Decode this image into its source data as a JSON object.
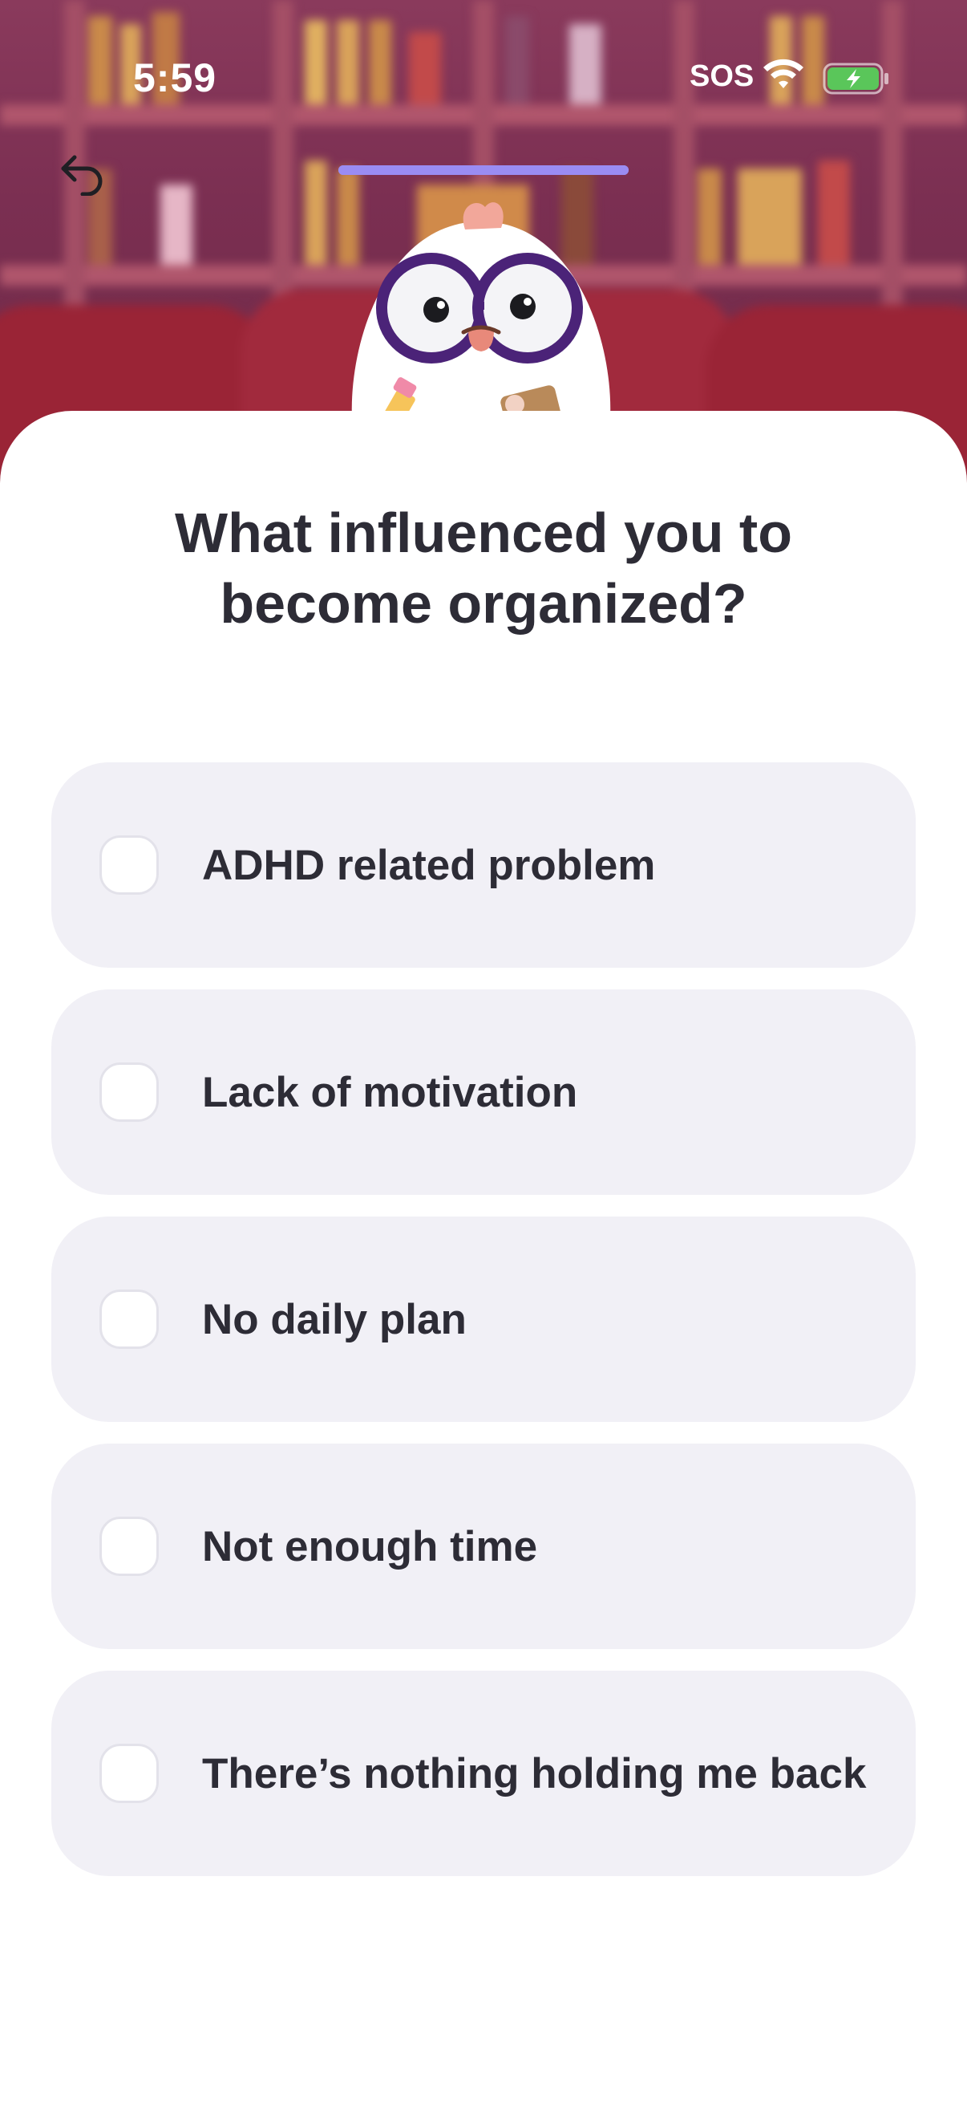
{
  "status_bar": {
    "time": "5:59",
    "carrier": "SOS",
    "wifi_icon": "wifi-icon",
    "battery_icon": "battery-charging-icon"
  },
  "nav": {
    "back_icon": "back-arrow-icon",
    "progress": 1.0
  },
  "question": {
    "title": "What influenced you to become organized?"
  },
  "options": [
    {
      "label": "ADHD related problem",
      "checked": false
    },
    {
      "label": "Lack of motivation",
      "checked": false
    },
    {
      "label": "No daily plan",
      "checked": false
    },
    {
      "label": "Not enough time",
      "checked": false
    },
    {
      "label": "There’s nothing holding me back",
      "checked": false
    }
  ],
  "colors": {
    "accent": "#9a8cf3",
    "option_bg": "#f1f0f6",
    "text": "#2d2c36",
    "hero_bg": "#7b2f52"
  }
}
